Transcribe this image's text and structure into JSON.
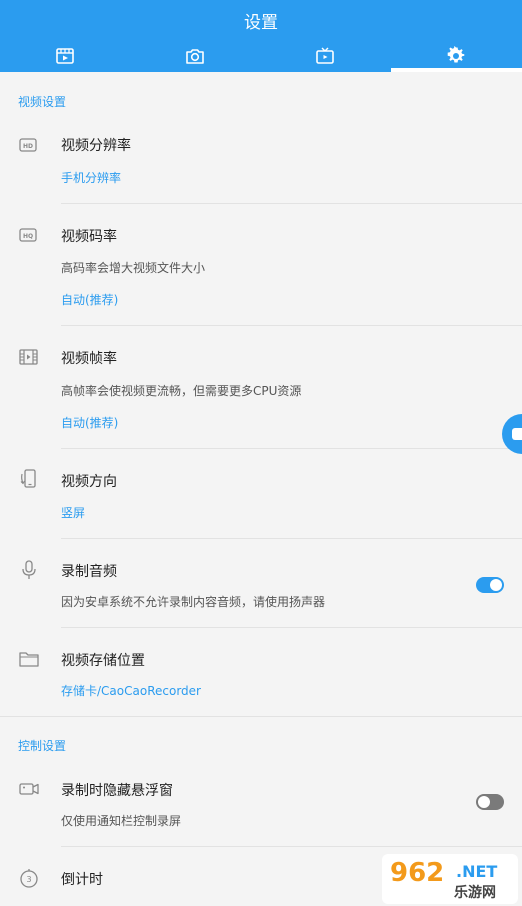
{
  "header": {
    "title": "设置",
    "tabs": [
      {
        "icon": "video-file-icon"
      },
      {
        "icon": "camera-icon"
      },
      {
        "icon": "tv-icon"
      },
      {
        "icon": "gear-icon",
        "active": true
      }
    ]
  },
  "sections": {
    "video": {
      "heading": "视频设置",
      "resolution": {
        "title": "视频分辨率",
        "value": "手机分辨率"
      },
      "bitrate": {
        "title": "视频码率",
        "desc": "高码率会增大视频文件大小",
        "value": "自动(推荐)"
      },
      "framerate": {
        "title": "视频帧率",
        "desc": "高帧率会使视频更流畅，但需要更多CPU资源",
        "value": "自动(推荐)"
      },
      "orientation": {
        "title": "视频方向",
        "value": "竖屏"
      },
      "audio": {
        "title": "录制音频",
        "desc": "因为安卓系统不允许录制内容音频，请使用扬声器",
        "toggle": true
      },
      "storage": {
        "title": "视频存储位置",
        "value": "存储卡/CaoCaoRecorder"
      }
    },
    "control": {
      "heading": "控制设置",
      "hide_float": {
        "title": "录制时隐藏悬浮窗",
        "desc": "仅使用通知栏控制录屏",
        "toggle": false
      },
      "countdown": {
        "title": "倒计时"
      }
    }
  },
  "watermark": {
    "number": "962",
    "net": ".NET",
    "cn": "乐游网"
  },
  "colors": {
    "accent": "#2b9cef",
    "background": "#f4f4f4"
  }
}
